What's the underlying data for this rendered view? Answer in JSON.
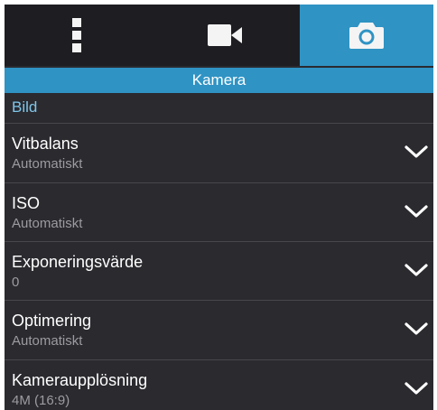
{
  "tabs": [
    {
      "icon": "more-vert-icon",
      "active": false
    },
    {
      "icon": "videocam-icon",
      "active": false
    },
    {
      "icon": "camera-icon",
      "active": true
    }
  ],
  "title": "Kamera",
  "section": "Bild",
  "settings": [
    {
      "label": "Vitbalans",
      "value": "Automatiskt",
      "icon": "chevron-down-icon"
    },
    {
      "label": "ISO",
      "value": "Automatiskt",
      "icon": "chevron-down-icon"
    },
    {
      "label": "Exponeringsvärde",
      "value": "0",
      "icon": "chevron-down-icon"
    },
    {
      "label": "Optimering",
      "value": "Automatiskt",
      "icon": "chevron-down-icon"
    },
    {
      "label": "Kameraupplösning",
      "value": "4M (16:9)",
      "icon": "chevron-down-icon"
    }
  ],
  "colors": {
    "accent": "#2f93c4",
    "section_text": "#7fc6ea",
    "background": "#2a2a2f",
    "tab_background": "#1e1e22",
    "secondary_text": "#9c9ca0"
  }
}
